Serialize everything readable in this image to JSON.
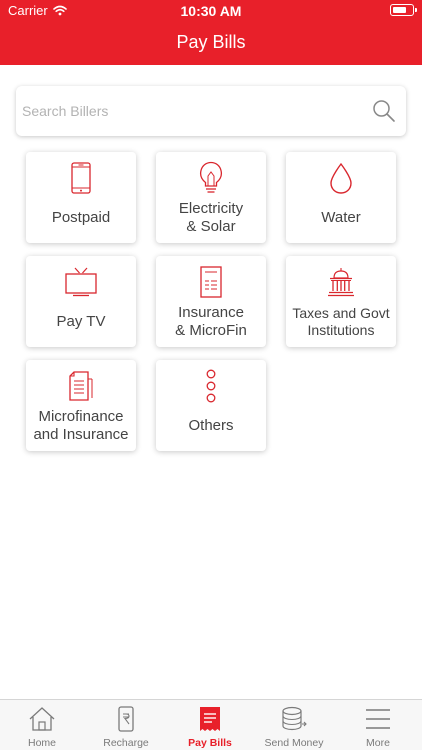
{
  "status_bar": {
    "carrier": "Carrier",
    "time": "10:30 AM"
  },
  "header": {
    "title": "Pay Bills"
  },
  "search": {
    "placeholder": "Search Billers",
    "icon": "search-icon"
  },
  "colors": {
    "accent": "#e8202a",
    "tile_icon": "#d9272e",
    "tab_inactive": "#7a7a7a"
  },
  "billers": [
    {
      "label": "Postpaid",
      "icon": "mobile-phone-icon"
    },
    {
      "label": "Electricity\n& Solar",
      "icon": "light-bulb-icon"
    },
    {
      "label": "Water",
      "icon": "water-drop-icon"
    },
    {
      "label": "Pay TV",
      "icon": "tv-icon"
    },
    {
      "label": "Insurance\n& MicroFin",
      "icon": "document-icon"
    },
    {
      "label": "Taxes and Govt\nInstitutions",
      "icon": "government-building-icon"
    },
    {
      "label": "Microfinance\nand Insurance",
      "icon": "invoice-icon"
    },
    {
      "label": "Others",
      "icon": "more-dots-icon"
    }
  ],
  "tabs": [
    {
      "label": "Home",
      "icon": "home-icon",
      "active": false
    },
    {
      "label": "Recharge",
      "icon": "recharge-icon",
      "active": false
    },
    {
      "label": "Pay Bills",
      "icon": "bill-icon",
      "active": true
    },
    {
      "label": "Send Money",
      "icon": "coins-icon",
      "active": false
    },
    {
      "label": "More",
      "icon": "menu-icon",
      "active": false
    }
  ]
}
